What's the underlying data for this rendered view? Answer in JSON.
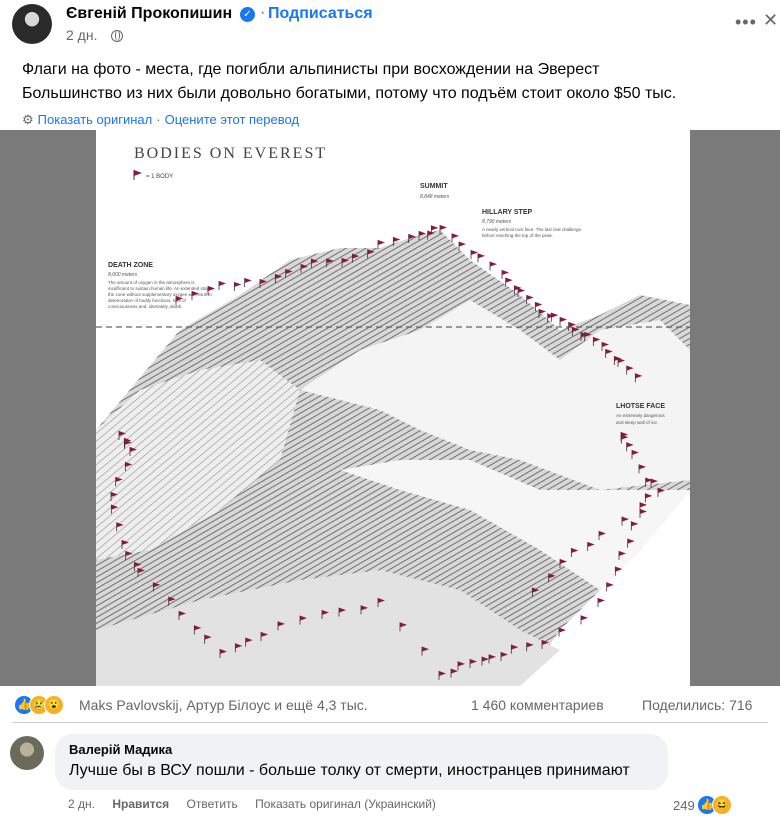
{
  "post": {
    "author": "Євгеній Прокопишин",
    "subscribe_label": "Подписаться",
    "time": "2 дн.",
    "text_line1": "Флаги на фото - места, где погибли альпинисты при восхождении на Эверест",
    "text_line2": "Большинство из них были довольно богатыми, потому что подъём стоит около $50 тыс.",
    "show_original": "Показать оригинал",
    "rate_translation": "Оцените этот перевод"
  },
  "image": {
    "title": "BODIES ON EVEREST",
    "legend": "= 1 BODY",
    "summit_label": "SUMMIT",
    "summit_height": "8,848 meters",
    "hillary_label": "HILLARY STEP",
    "hillary_height": "8,790 meters",
    "hillary_desc_1": "A nearly vertical rock face. The last real challenge",
    "hillary_desc_2": "before reaching the top of the peak.",
    "death_zone_label": "DEATH ZONE",
    "death_zone_height": "8,000 meters",
    "death_zone_desc": [
      "The amount of oxygen in the atmosphere is",
      "insufficient to sustain human life. An extended stay in",
      "the zone without supplementary oxygen will result in",
      "deterioration of bodily functions, loss of",
      "consciousness and, ultimately, death."
    ],
    "lhotse_label": "LHOTSE FACE",
    "lhotse_desc_1": "An extremely dangerous",
    "lhotse_desc_2": "and steep wall of ice.",
    "flag_color": "#8b1a3a"
  },
  "reactions": {
    "reactors": "Maks Pavlovskij, Артур Білоус и ещё 4,3 тыс.",
    "comments": "1 460 комментариев",
    "shares": "Поделились: 716"
  },
  "comment": {
    "author": "Валерій Мадика",
    "text": "Лучше бы в ВСУ пошли - больше толку от смерти, иностранцев принимают",
    "time": "2 дн.",
    "like_label": "Нравится",
    "reply_label": "Ответить",
    "show_original": "Показать оригинал (Украинский)",
    "reaction_count": "249"
  },
  "icons": {
    "verified": "verified-badge-icon",
    "globe": "globe-icon",
    "more": "more-options-icon",
    "close": "close-icon",
    "translate": "translate-gear-icon"
  },
  "colors": {
    "link": "#1877f2",
    "secondary_text": "#65676b",
    "comment_bubble": "#f0f2f5"
  }
}
